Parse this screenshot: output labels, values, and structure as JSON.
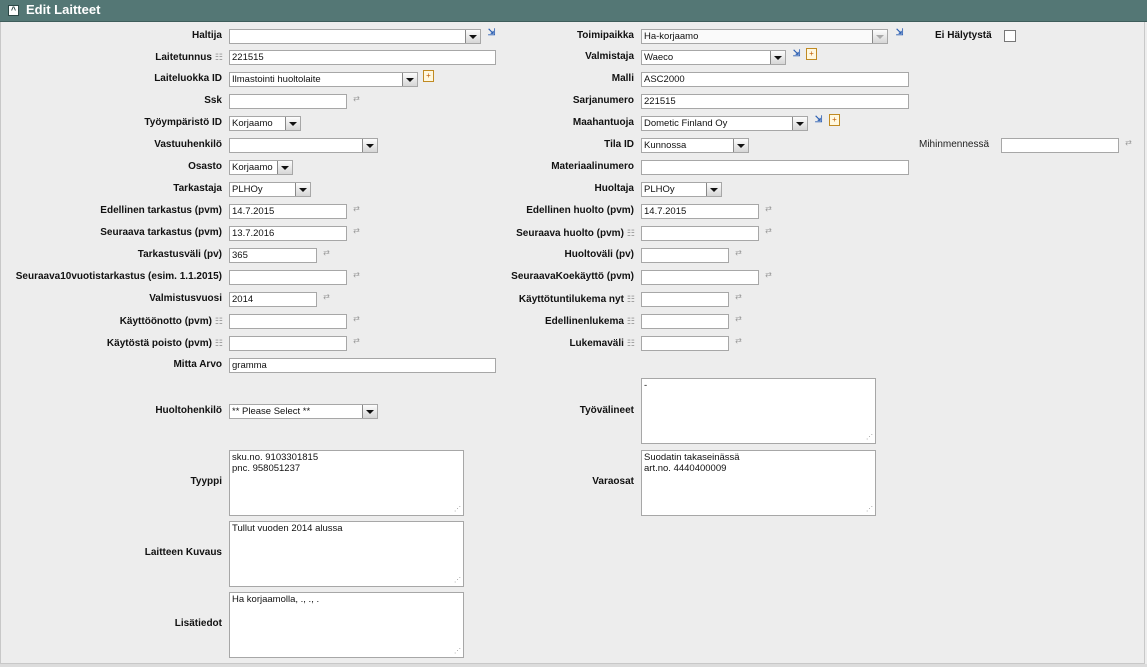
{
  "window": {
    "title": "Edit Laitteet"
  },
  "fields": {
    "haltija": {
      "label": "Haltija",
      "value": ""
    },
    "toimipaikka": {
      "label": "Toimipaikka",
      "value": "Ha-korjaamo"
    },
    "ei_halytysta": {
      "label": "Ei Hälytystä",
      "checked": false
    },
    "laitetunnus": {
      "label": "Laitetunnus",
      "value": "221515"
    },
    "valmistaja": {
      "label": "Valmistaja",
      "value": "Waeco"
    },
    "laiteluokka": {
      "label": "Laiteluokka ID",
      "value": "Ilmastointi huoltolaite"
    },
    "malli": {
      "label": "Malli",
      "value": "ASC2000"
    },
    "ssk": {
      "label": "Ssk",
      "value": ""
    },
    "sarjanumero": {
      "label": "Sarjanumero",
      "value": "221515"
    },
    "tyoymparisto": {
      "label": "Työympäristö ID",
      "value": "Korjaamo"
    },
    "maahantuoja": {
      "label": "Maahantuoja",
      "value": "Dometic Finland Oy"
    },
    "vastuuhenkilo": {
      "label": "Vastuuhenkilö",
      "value": ""
    },
    "tila": {
      "label": "Tila ID",
      "value": "Kunnossa"
    },
    "mihinmennessa": {
      "label": "Mihinmennessä",
      "value": ""
    },
    "osasto": {
      "label": "Osasto",
      "value": "Korjaamo"
    },
    "materiaalinumero": {
      "label": "Materiaalinumero",
      "value": ""
    },
    "tarkastaja": {
      "label": "Tarkastaja",
      "value": "PLHOy"
    },
    "huoltaja": {
      "label": "Huoltaja",
      "value": "PLHOy"
    },
    "edellinen_tarkastus": {
      "label": "Edellinen tarkastus (pvm)",
      "value": "14.7.2015"
    },
    "edellinen_huolto": {
      "label": "Edellinen huolto (pvm)",
      "value": "14.7.2015"
    },
    "seuraava_tarkastus": {
      "label": "Seuraava tarkastus (pvm)",
      "value": "13.7.2016"
    },
    "seuraava_huolto": {
      "label": "Seuraava huolto (pvm)",
      "value": ""
    },
    "tarkastusvali": {
      "label": "Tarkastusväli (pv)",
      "value": "365"
    },
    "huoltovali": {
      "label": "Huoltoväli (pv)",
      "value": ""
    },
    "seuraava10": {
      "label": "Seuraava10vuotistarkastus (esim. 1.1.2015)",
      "value": ""
    },
    "seuraava_koekaytto": {
      "label": "SeuraavaKoekäyttö (pvm)",
      "value": ""
    },
    "valmistusvuosi": {
      "label": "Valmistusvuosi",
      "value": "2014"
    },
    "kayttotuntilukema": {
      "label": "Käyttötuntilukema nyt",
      "value": ""
    },
    "kayttoonotto": {
      "label": "Käyttöönotto (pvm)",
      "value": ""
    },
    "edellinenlukema": {
      "label": "Edellinenlukema",
      "value": ""
    },
    "kaytosta_poisto": {
      "label": "Käytöstä poisto (pvm)",
      "value": ""
    },
    "lukemavali": {
      "label": "Lukemaväli",
      "value": ""
    },
    "mitta_arvo": {
      "label": "Mitta Arvo",
      "value": "gramma"
    },
    "huoltohenkilo": {
      "label": "Huoltohenkilö",
      "value": "** Please Select **"
    },
    "tyovalineet": {
      "label": "Työvälineet",
      "value": "-"
    },
    "tyyppi": {
      "label": "Tyyppi",
      "value": "sku.no. 9103301815\npnc. 958051237"
    },
    "varaosat": {
      "label": "Varaosat",
      "value": "Suodatin takaseinässä\nart.no. 4440400009"
    },
    "laitteen_kuvaus": {
      "label": "Laitteen Kuvaus",
      "value": "Tullut vuoden 2014 alussa"
    },
    "lisatiedot": {
      "label": "Lisätiedot",
      "value": "Ha korjaamolla, ., ., ."
    }
  },
  "icons": {
    "list_hint": "list-indicator-icon",
    "spinner": "up-down-spinner-icon",
    "lookup": "lookup-picker-icon",
    "add_new": "add-new-record-icon",
    "collapse": "collapse-panel-icon"
  },
  "colors": {
    "titlebar": "#547775",
    "panel_background": "#ededed"
  }
}
